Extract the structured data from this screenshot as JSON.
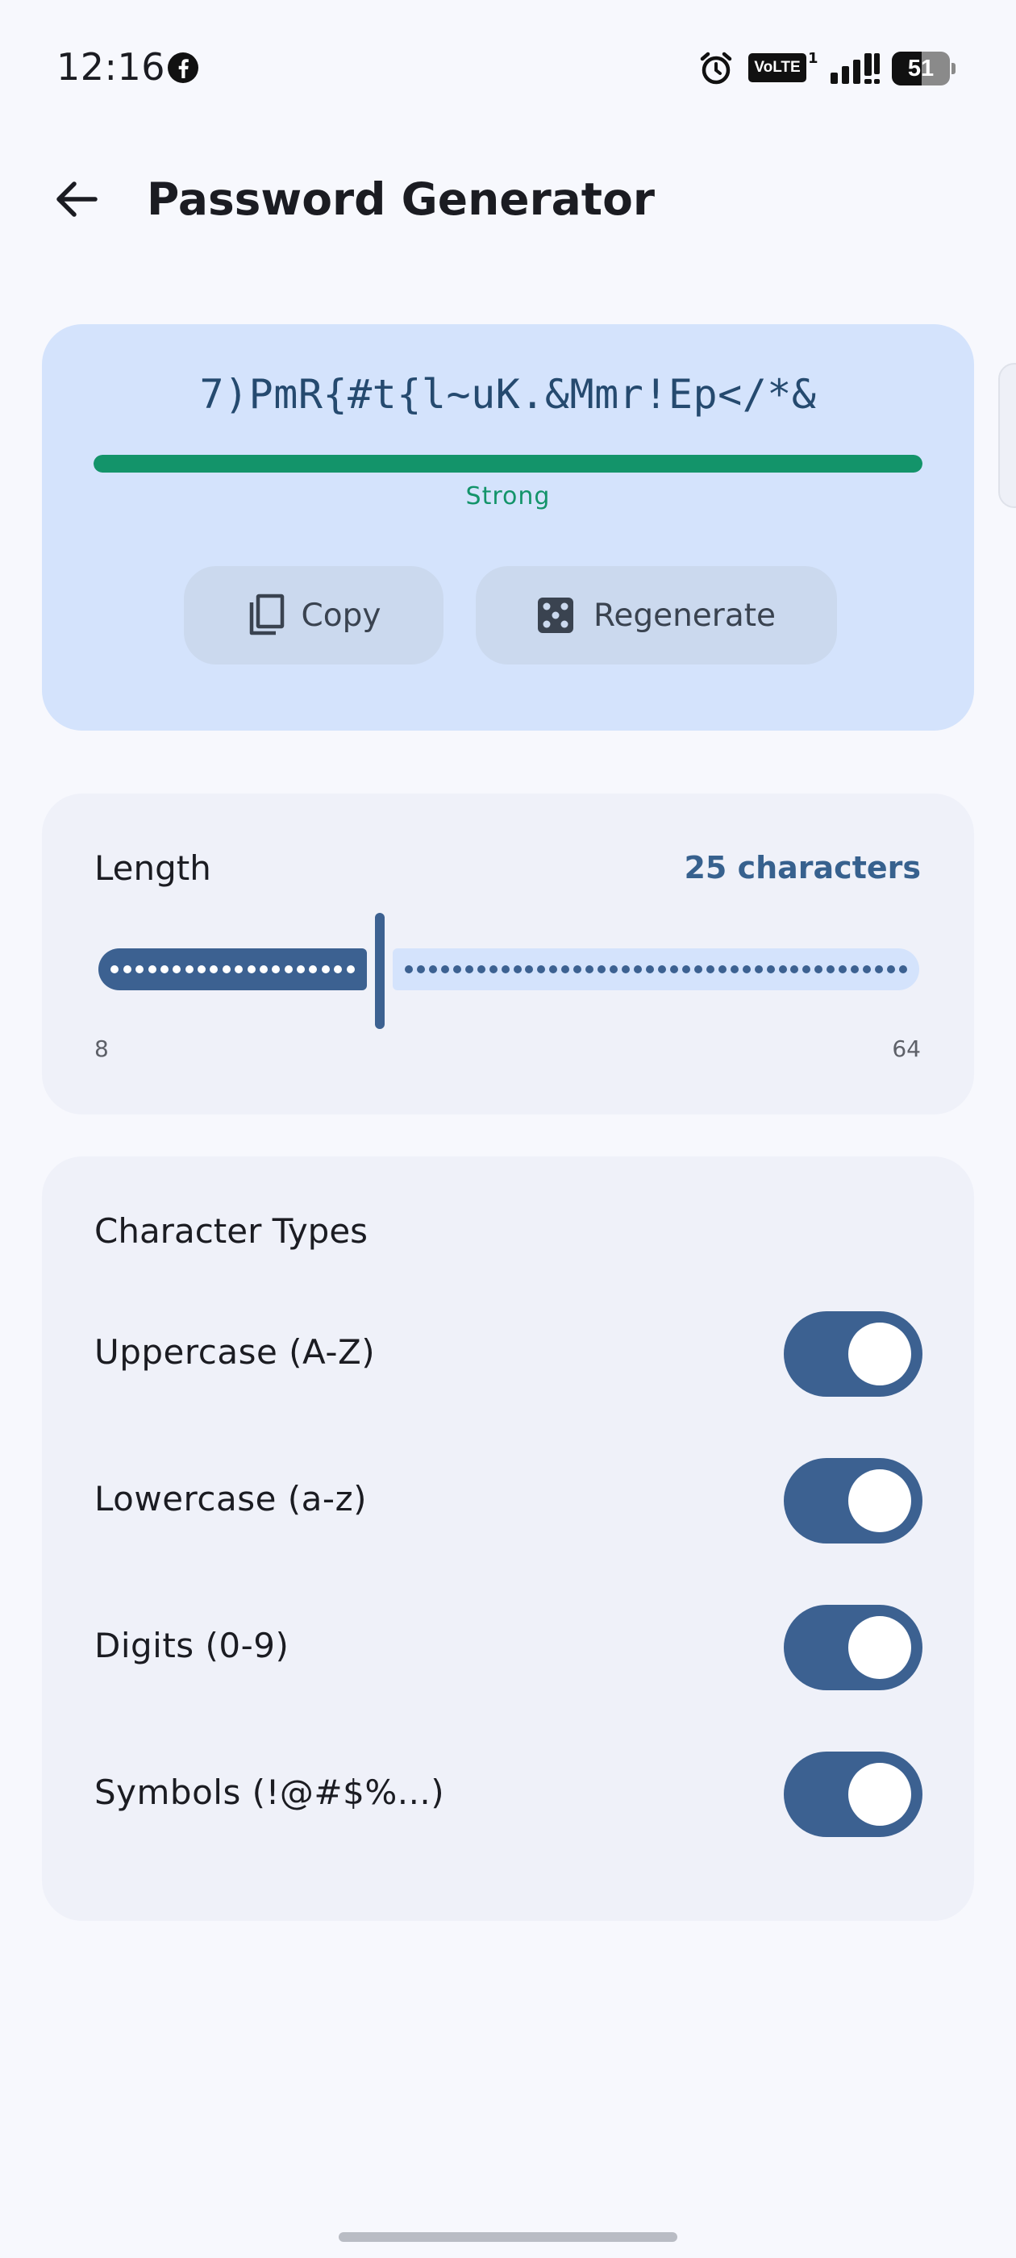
{
  "status_bar": {
    "time": "12:16",
    "network_badge": "VoLTE",
    "network_sup": "1",
    "battery_level": "51",
    "battery_fraction": 0.51
  },
  "app_bar": {
    "title": "Password Generator",
    "back_icon": "arrow-left-icon"
  },
  "password": {
    "value": "7)PmR{#t{l~uK.&Mmr!Ep</*&",
    "strength_label": "Strong",
    "strength_fraction": 1.0,
    "strength_color": "#13946a",
    "copy_label": "Copy",
    "copy_icon": "copy-icon",
    "regenerate_label": "Regenerate",
    "regenerate_icon": "dice-icon"
  },
  "length": {
    "title": "Length",
    "value_label": "25 characters",
    "value": 25,
    "min": 8,
    "max": 64,
    "min_label": "8",
    "max_label": "64"
  },
  "character_types": {
    "title": "Character Types",
    "items": [
      {
        "label": "Uppercase (A-Z)",
        "enabled": true
      },
      {
        "label": "Lowercase (a-z)",
        "enabled": true
      },
      {
        "label": "Digits (0-9)",
        "enabled": true
      },
      {
        "label": "Symbols (!@#$%...)",
        "enabled": true
      }
    ]
  },
  "colors": {
    "primary": "#3c6191",
    "card_password": "#d4e3fc",
    "card_surface": "#eff1f9",
    "background": "#f7f8fd",
    "strong": "#13946a"
  }
}
